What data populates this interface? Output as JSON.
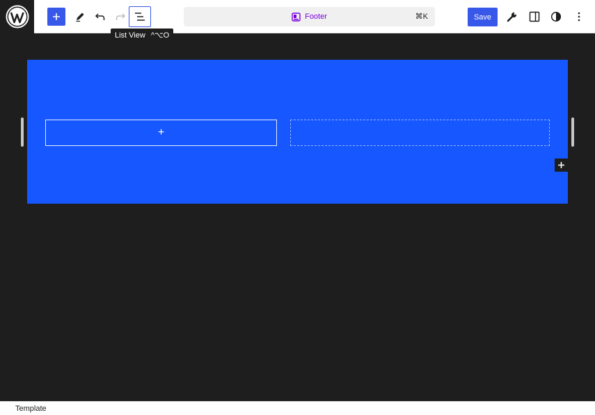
{
  "toolbar": {
    "tooltip_label": "List View",
    "tooltip_shortcut": "^⌥O",
    "document_title": "Footer",
    "command_shortcut": "⌘K",
    "save_label": "Save"
  },
  "icons": {
    "site": "wordpress-logo-icon",
    "add": "plus-icon",
    "tools": "pencil-icon",
    "undo": "undo-icon",
    "redo": "redo-icon",
    "list_view": "list-view-icon",
    "template_part": "template-part-icon",
    "settings_tools": "wrench-icon",
    "settings_sidebar": "sidebar-icon",
    "styles": "half-circle-icon",
    "options": "more-vertical-icon"
  },
  "canvas": {
    "column_left_placeholder": "+",
    "block_inserter_label": "+"
  },
  "statusbar": {
    "breadcrumb": "Template"
  },
  "colors": {
    "accent": "#3858e9",
    "footer_background": "#1657ff",
    "canvas_background": "#1e1e1e",
    "template_part_color": "#7a00df"
  }
}
